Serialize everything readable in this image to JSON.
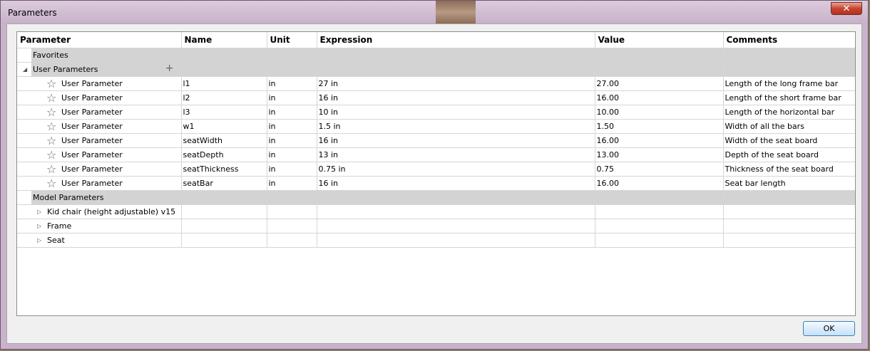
{
  "window": {
    "title": "Parameters",
    "close_label": "✕"
  },
  "columns": [
    "Parameter",
    "Name",
    "Unit",
    "Expression",
    "Value",
    "Comments"
  ],
  "groups": {
    "favorites": "Favorites",
    "user_parameters": "User Parameters",
    "model_parameters": "Model Parameters"
  },
  "user_params": [
    {
      "type": "User Parameter",
      "name": "l1",
      "unit": "in",
      "expression": "27 in",
      "value": "27.00",
      "comment": "Length of the long frame bar"
    },
    {
      "type": "User Parameter",
      "name": "l2",
      "unit": "in",
      "expression": "16 in",
      "value": "16.00",
      "comment": "Length of the short frame bar"
    },
    {
      "type": "User Parameter",
      "name": "l3",
      "unit": "in",
      "expression": "10 in",
      "value": "10.00",
      "comment": "Length of the horizontal bar"
    },
    {
      "type": "User Parameter",
      "name": "w1",
      "unit": "in",
      "expression": "1.5 in",
      "value": "1.50",
      "comment": "Width of all the bars"
    },
    {
      "type": "User Parameter",
      "name": "seatWidth",
      "unit": "in",
      "expression": "16 in",
      "value": "16.00",
      "comment": "Width of the seat board"
    },
    {
      "type": "User Parameter",
      "name": "seatDepth",
      "unit": "in",
      "expression": "13 in",
      "value": "13.00",
      "comment": "Depth of the seat board"
    },
    {
      "type": "User Parameter",
      "name": "seatThickness",
      "unit": "in",
      "expression": "0.75 in",
      "value": "0.75",
      "comment": "Thickness of the seat board"
    },
    {
      "type": "User Parameter",
      "name": "seatBar",
      "unit": "in",
      "expression": "16 in",
      "value": "16.00",
      "comment": "Seat bar length"
    }
  ],
  "model_items": [
    "Kid chair (height adjustable) v15",
    "Frame",
    "Seat"
  ],
  "ok_label": "OK",
  "icons": {
    "star": "star-icon",
    "expanded": "expanded-triangle-icon",
    "collapsed": "collapsed-triangle-icon",
    "add": "plus-icon"
  }
}
